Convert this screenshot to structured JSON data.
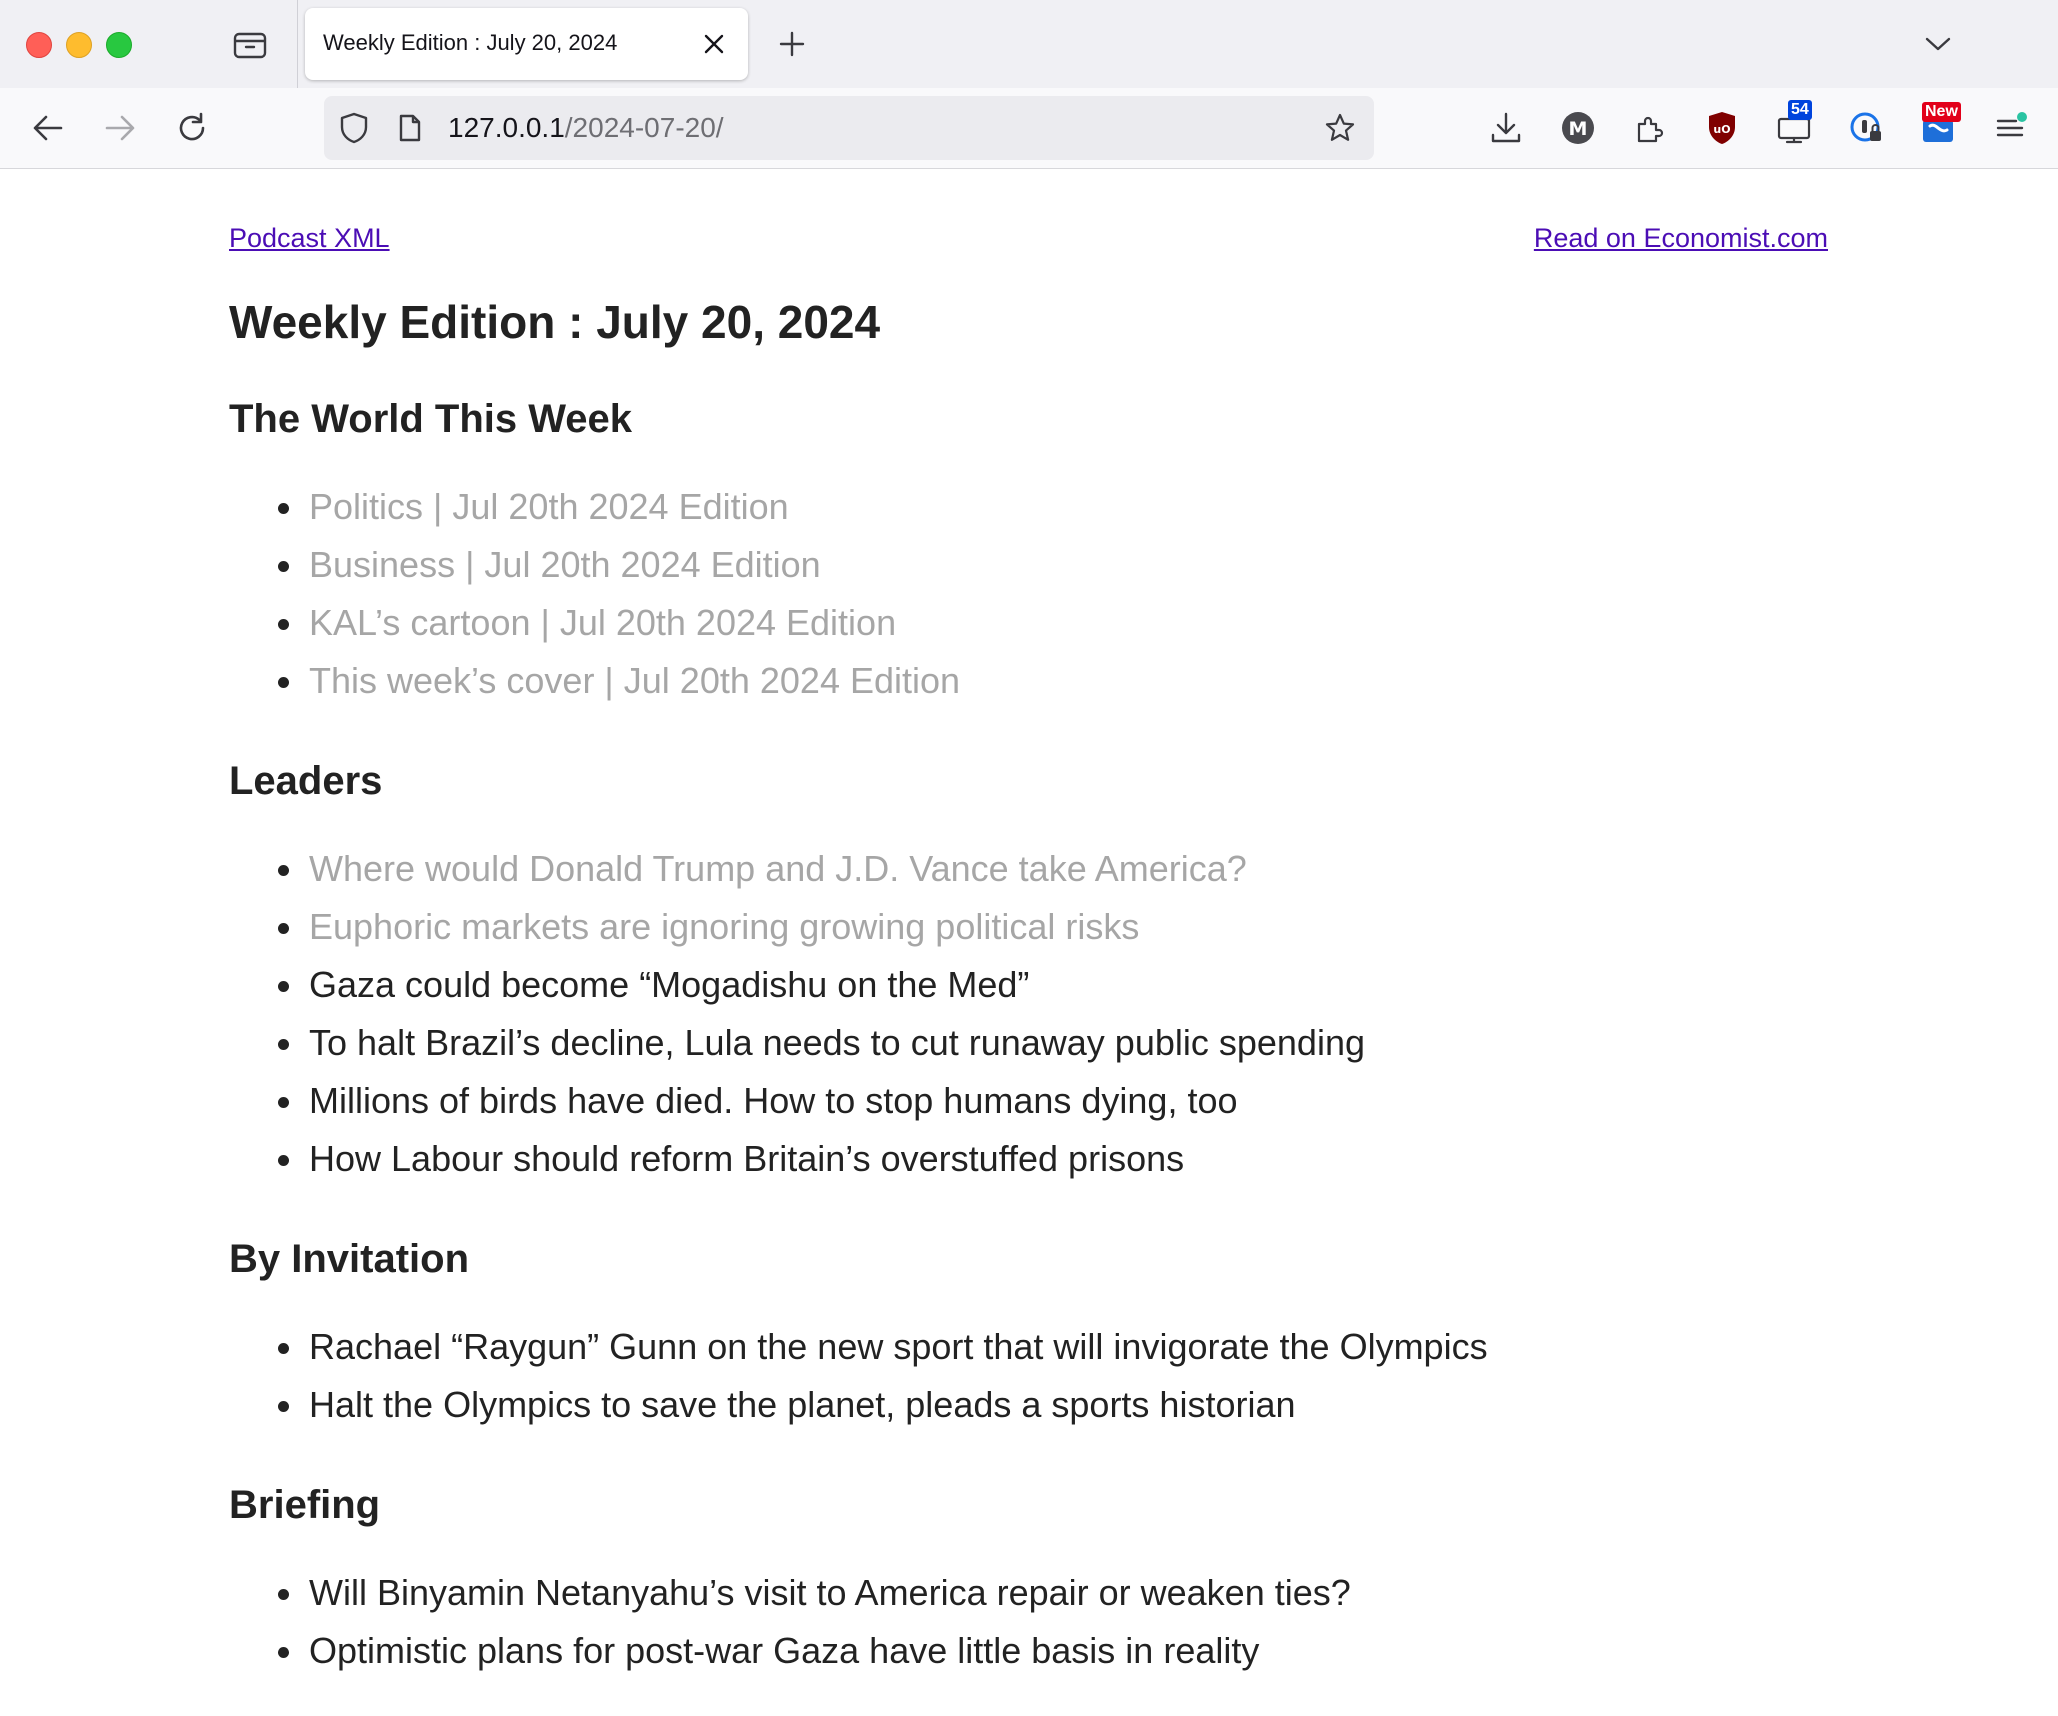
{
  "tab": {
    "title": "Weekly Edition : July 20, 2024"
  },
  "url": {
    "host": "127.0.0.1",
    "path": "/2024-07-20/"
  },
  "extensions": {
    "screen_badge": "54",
    "news_badge": "New",
    "accent_colors": {
      "ublock": "#800000",
      "screen_badge_bg": "#0044dd",
      "news_badge_bg": "#e2001a",
      "dot": "#2ac3a2"
    }
  },
  "page": {
    "podcast_link": "Podcast XML",
    "economist_link": "Read on Economist.com",
    "title": "Weekly Edition : July 20, 2024",
    "sections": [
      {
        "heading": "The World This Week",
        "items": [
          {
            "text": "Politics | Jul 20th 2024 Edition",
            "visited": true
          },
          {
            "text": "Business | Jul 20th 2024 Edition",
            "visited": true
          },
          {
            "text": "KAL’s cartoon | Jul 20th 2024 Edition",
            "visited": true
          },
          {
            "text": "This week’s cover | Jul 20th 2024 Edition",
            "visited": true
          }
        ]
      },
      {
        "heading": "Leaders",
        "items": [
          {
            "text": "Where would Donald Trump and J.D. Vance take America?",
            "visited": true
          },
          {
            "text": "Euphoric markets are ignoring growing political risks",
            "visited": true
          },
          {
            "text": "Gaza could become “Mogadishu on the Med”",
            "visited": false
          },
          {
            "text": "To halt Brazil’s decline, Lula needs to cut runaway public spending",
            "visited": false
          },
          {
            "text": "Millions of birds have died. How to stop humans dying, too",
            "visited": false
          },
          {
            "text": "How Labour should reform Britain’s overstuffed prisons",
            "visited": false
          }
        ]
      },
      {
        "heading": "By Invitation",
        "items": [
          {
            "text": "Rachael “Raygun” Gunn on the new sport that will invigorate the Olympics",
            "visited": false
          },
          {
            "text": "Halt the Olympics to save the planet, pleads a sports historian",
            "visited": false
          }
        ]
      },
      {
        "heading": "Briefing",
        "items": [
          {
            "text": "Will Binyamin Netanyahu’s visit to America repair or weaken ties?",
            "visited": false
          },
          {
            "text": "Optimistic plans for post-war Gaza have little basis in reality",
            "visited": false
          }
        ]
      }
    ]
  }
}
